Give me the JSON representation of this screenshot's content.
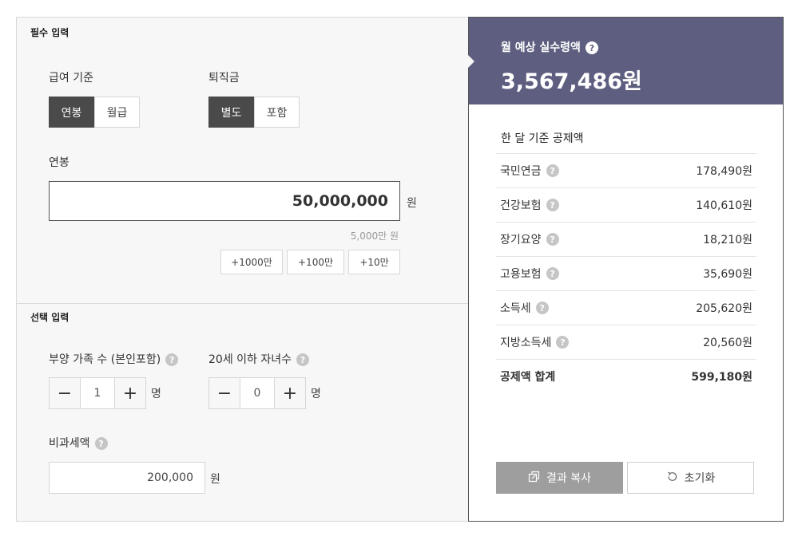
{
  "required": {
    "section_title": "필수 입력",
    "pay_basis": {
      "label": "급여 기준",
      "options": [
        "연봉",
        "월급"
      ],
      "selected": "연봉"
    },
    "severance": {
      "label": "퇴직금",
      "options": [
        "별도",
        "포함"
      ],
      "selected": "별도"
    },
    "salary": {
      "label": "연봉",
      "value": "50,000,000",
      "unit": "원",
      "hint": "5,000만 원"
    },
    "increment_buttons": [
      "+1000만",
      "+100만",
      "+10만"
    ]
  },
  "optional": {
    "section_title": "선택 입력",
    "dependents": {
      "label": "부양 가족 수 (본인포함)",
      "value": "1",
      "unit": "명"
    },
    "children": {
      "label": "20세 이하 자녀수",
      "value": "0",
      "unit": "명"
    },
    "nontax": {
      "label": "비과세액",
      "value": "200,000",
      "unit": "원"
    }
  },
  "result": {
    "title": "월 예상 실수령액",
    "amount": "3,567,486원",
    "deduction_title": "한 달 기준 공제액",
    "deductions": [
      {
        "name": "국민연금",
        "value": "178,490원"
      },
      {
        "name": "건강보험",
        "value": "140,610원"
      },
      {
        "name": "장기요양",
        "value": "18,210원"
      },
      {
        "name": "고용보험",
        "value": "35,690원"
      },
      {
        "name": "소득세",
        "value": "205,620원"
      },
      {
        "name": "지방소득세",
        "value": "20,560원"
      }
    ],
    "total": {
      "name": "공제액 합계",
      "value": "599,180원"
    },
    "copy_label": "결과 복사",
    "reset_label": "초기화"
  },
  "colors": {
    "accent": "#5e5f80",
    "active_segment": "#4a4a4a",
    "copy_button": "#9e9e9e"
  },
  "icons": {
    "help": "?",
    "minus": "−",
    "plus": "+",
    "copy": "copy-icon",
    "reset": "reset-icon"
  }
}
